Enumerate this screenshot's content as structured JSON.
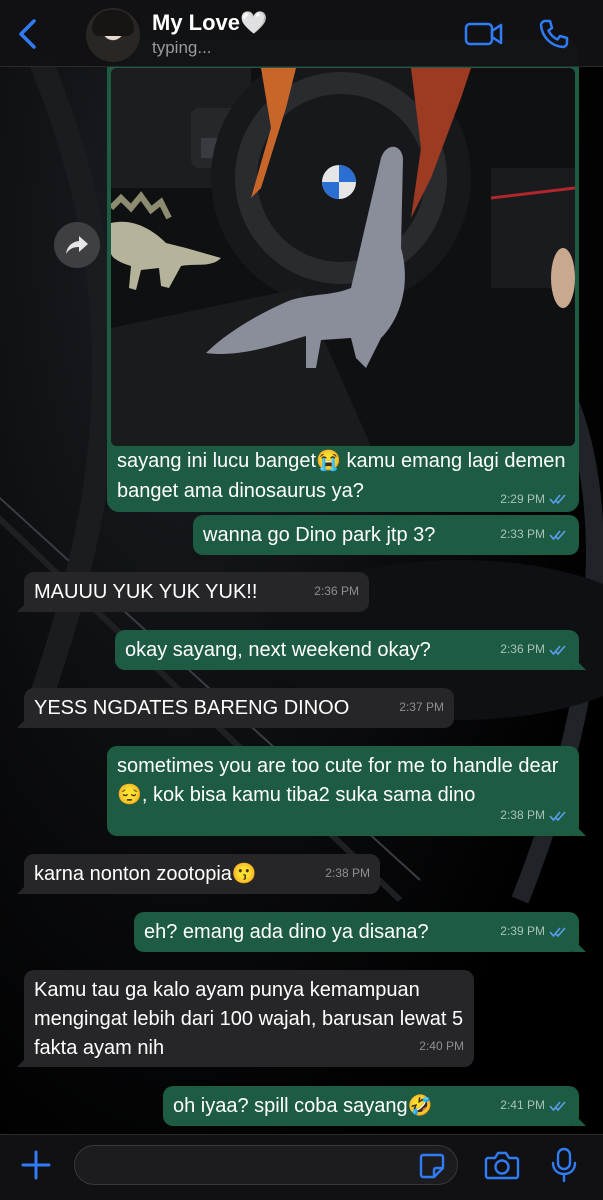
{
  "header": {
    "contact_name": "My Love🤍",
    "status": "typing..."
  },
  "image_message": {
    "caption": "sayang ini lucu banget😭 kamu emang lagi demen banget ama dinosaurus ya?",
    "time": "2:29 PM"
  },
  "messages": [
    {
      "dir": "out",
      "text": "wanna go Dino park jtp 3?",
      "time": "2:33 PM"
    },
    {
      "dir": "in",
      "text": "MAUUU YUK YUK YUK!!",
      "time": "2:36 PM"
    },
    {
      "dir": "out",
      "text": "okay sayang, next weekend okay?",
      "time": "2:36 PM"
    },
    {
      "dir": "in",
      "text": "YESS NGDATES BARENG DINOO",
      "time": "2:37 PM"
    },
    {
      "dir": "out",
      "text": "sometimes you are too cute for me to handle dear😔, kok bisa kamu tiba2 suka sama dino",
      "time": "2:38 PM"
    },
    {
      "dir": "in",
      "text": "karna nonton zootopia😗",
      "time": "2:38 PM"
    },
    {
      "dir": "out",
      "text": "eh? emang ada dino ya disana?",
      "time": "2:39 PM"
    },
    {
      "dir": "in",
      "text": "Kamu tau ga kalo ayam punya kemampuan mengingat lebih dari 100 wajah, barusan lewat 5 fakta ayam nih",
      "time": "2:40 PM"
    },
    {
      "dir": "out",
      "text": "oh iyaa? spill coba sayang🤣",
      "time": "2:41 PM"
    }
  ],
  "input": {
    "value": ""
  },
  "colors": {
    "outgoing": "#1d5b43",
    "incoming": "#262628",
    "accent": "#2f7cf6"
  },
  "icons": [
    "back-chevron-icon",
    "video-call-icon",
    "phone-icon",
    "forward-icon",
    "double-check-icon",
    "plus-icon",
    "sticker-icon",
    "camera-icon",
    "microphone-icon"
  ]
}
